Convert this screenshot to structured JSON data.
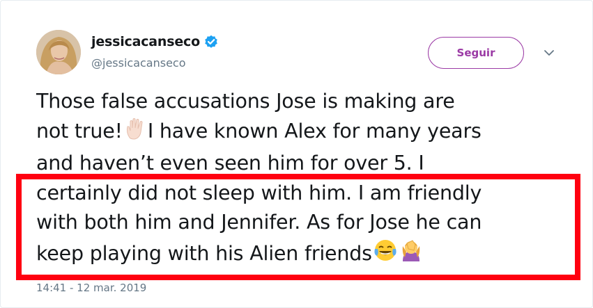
{
  "user": {
    "display_name": "jessicacanseco",
    "handle": "@jessicacanseco",
    "verified": true,
    "avatar_icon": "profile-photo"
  },
  "actions": {
    "follow_label": "Seguir",
    "more_icon": "chevron-down-icon"
  },
  "tweet": {
    "lines": [
      "Those false accusations Jose is making are",
      "not true!",
      "I have  known Alex for many years",
      "and haven’t even seen him for over 5. I",
      "certainly did not sleep with him. I am friendly",
      "with both him and Jennifer. As for Jose he can",
      "keep playing with his Alien friends"
    ],
    "emojis": [
      "raised-hand-icon",
      "tears-of-joy-icon",
      "facepalm-icon"
    ],
    "timestamp": "14:41 - 12 mar. 2019"
  },
  "colors": {
    "follow_accent": "#9b3aa5",
    "verified_blue": "#1da1f2",
    "highlight_red": "#ff0010",
    "text": "#14171a",
    "muted": "#657786"
  }
}
